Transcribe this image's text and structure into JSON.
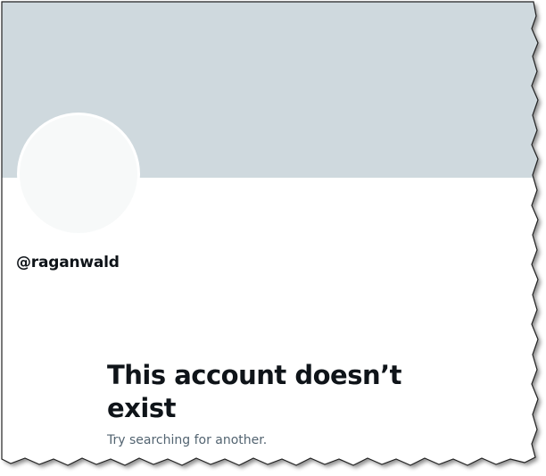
{
  "profile": {
    "handle": "@raganwald",
    "headline": "This account doesn’t exist",
    "subtext": "Try searching for another."
  },
  "colors": {
    "banner": "#cfd9de",
    "avatar": "#f7f9f9",
    "text_primary": "#0f1419",
    "text_secondary": "#536471"
  }
}
